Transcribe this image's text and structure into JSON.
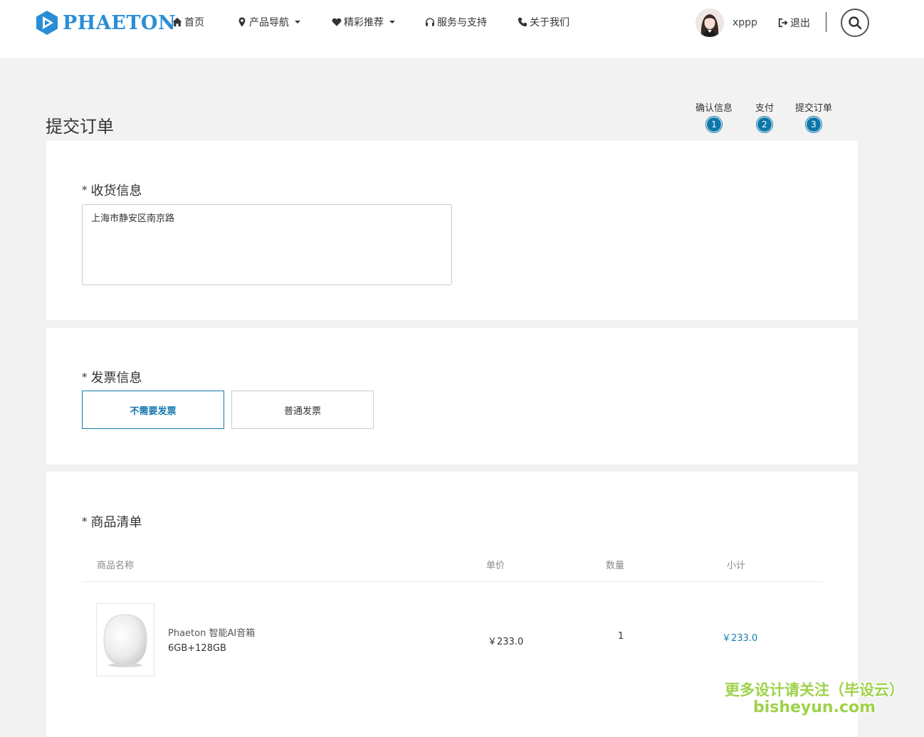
{
  "header": {
    "logo_text": "PHAETON",
    "nav": [
      {
        "label": "首页",
        "icon": "home-icon"
      },
      {
        "label": "产品导航",
        "icon": "map-marker-icon",
        "dropdown": true
      },
      {
        "label": "精彩推荐",
        "icon": "heart-icon",
        "dropdown": true
      },
      {
        "label": "服务与支持",
        "icon": "headphones-icon"
      },
      {
        "label": "关于我们",
        "icon": "phone-icon"
      }
    ],
    "username": "xppp",
    "logout_label": "退出"
  },
  "page": {
    "title": "提交订单",
    "steps": [
      {
        "label": "确认信息",
        "number": "1"
      },
      {
        "label": "支付",
        "number": "2"
      },
      {
        "label": "提交订单",
        "number": "3"
      }
    ]
  },
  "shipping": {
    "required_mark": "*",
    "label": "收货信息",
    "address": "上海市静安区南京路"
  },
  "invoice": {
    "required_mark": "*",
    "label": "发票信息",
    "options": [
      "不需要发票",
      "普通发票"
    ],
    "selected": "不需要发票"
  },
  "items": {
    "required_mark": "*",
    "label": "商品清单",
    "headers": [
      "商品名称",
      "单价",
      "数量",
      "小计"
    ],
    "rows": [
      {
        "name": "Phaeton 智能AI音箱",
        "spec": "6GB+128GB",
        "price": "￥233.0",
        "qty": "1",
        "subtotal": "￥233.0"
      }
    ]
  },
  "watermark": {
    "line1": "更多设计请关注（毕设云）",
    "line2": "bisheyun.com"
  },
  "colors": {
    "accent": "#0d77aa",
    "logo": "#2a8ed6",
    "watermark": "#9ed24a"
  }
}
